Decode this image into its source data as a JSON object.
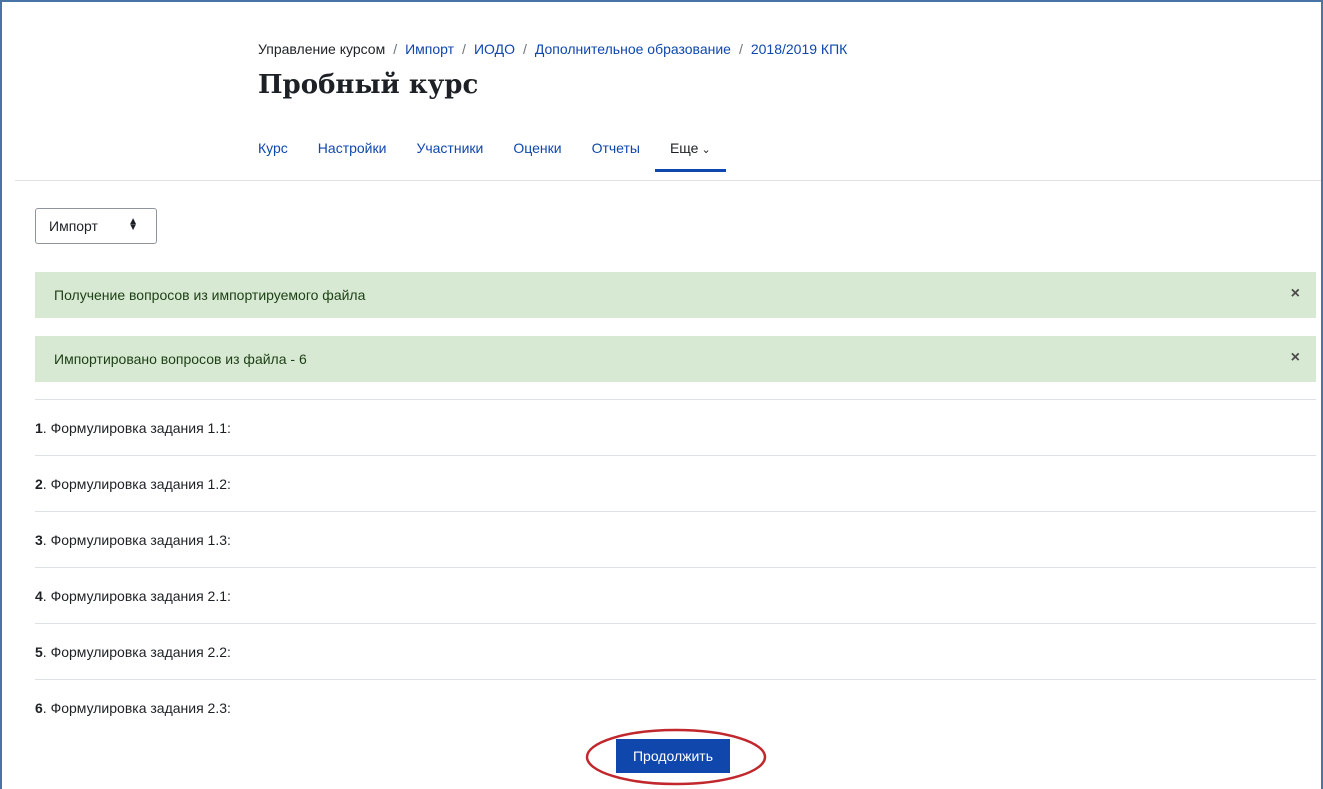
{
  "breadcrumb": {
    "items": [
      "Управление курсом",
      "Импорт",
      "ИОДО",
      "Дополнительное образование",
      "2018/2019 КПК"
    ],
    "separator": "/"
  },
  "page_title": "Пробный курс",
  "nav": {
    "tabs": [
      "Курс",
      "Настройки",
      "Участники",
      "Оценки",
      "Отчеты"
    ],
    "more_label": "Еще"
  },
  "select": {
    "value": "Импорт"
  },
  "alerts": [
    {
      "text": "Получение вопросов из импортируемого файла",
      "close": "×"
    },
    {
      "text": "Импортировано вопросов из файла - 6",
      "close": "×"
    }
  ],
  "questions": [
    {
      "num": "1",
      "text": ". Формулировка задания 1.1:"
    },
    {
      "num": "2",
      "text": ". Формулировка задания 1.2:"
    },
    {
      "num": "3",
      "text": ". Формулировка задания 1.3:"
    },
    {
      "num": "4",
      "text": ". Формулировка задания 2.1:"
    },
    {
      "num": "5",
      "text": ". Формулировка задания 2.2:"
    },
    {
      "num": "6",
      "text": ". Формулировка задания 2.3:"
    }
  ],
  "continue_button": "Продолжить",
  "colors": {
    "primary": "#0f47ad",
    "alert_bg": "#d7e9d2",
    "highlight": "#c0282d"
  }
}
